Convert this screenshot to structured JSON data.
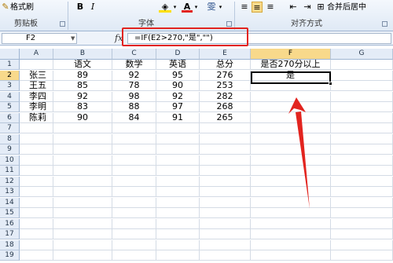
{
  "ribbon": {
    "format_painter": "格式刷",
    "clipboard_label": "剪贴板",
    "font_label": "字体",
    "alignment_label": "对齐方式",
    "merge_center": "合并后居中",
    "wen_button": "雯"
  },
  "formula_bar": {
    "name_box": "F2",
    "fx": "fx",
    "formula": "=IF(E2>270,\"是\",\"\")"
  },
  "columns": [
    "A",
    "B",
    "C",
    "D",
    "E",
    "F",
    "G"
  ],
  "selected_column": "F",
  "rows": [
    "1",
    "2",
    "3",
    "4",
    "5",
    "6",
    "7",
    "8",
    "9",
    "10",
    "11",
    "12",
    "13",
    "14",
    "15",
    "16",
    "17",
    "18",
    "19"
  ],
  "selected_row": "2",
  "headers": [
    "",
    "语文",
    "数学",
    "英语",
    "总分",
    "是否270分以上"
  ],
  "data_rows": [
    [
      "张三",
      "89",
      "92",
      "95",
      "276",
      "是"
    ],
    [
      "王五",
      "85",
      "78",
      "90",
      "253",
      ""
    ],
    [
      "李四",
      "92",
      "98",
      "92",
      "282",
      ""
    ],
    [
      "李明",
      "83",
      "88",
      "97",
      "268",
      ""
    ],
    [
      "陈莉",
      "90",
      "84",
      "91",
      "265",
      ""
    ]
  ],
  "colors": {
    "annotation_red": "#e2241f",
    "header_selected": "#f8d98b"
  },
  "icons": [
    "format-painter-icon",
    "bold-icon",
    "italic-icon",
    "fill-color-icon",
    "font-color-icon",
    "align-left-icon",
    "align-center-icon",
    "align-right-icon",
    "indent-icon",
    "merge-center-icon"
  ]
}
